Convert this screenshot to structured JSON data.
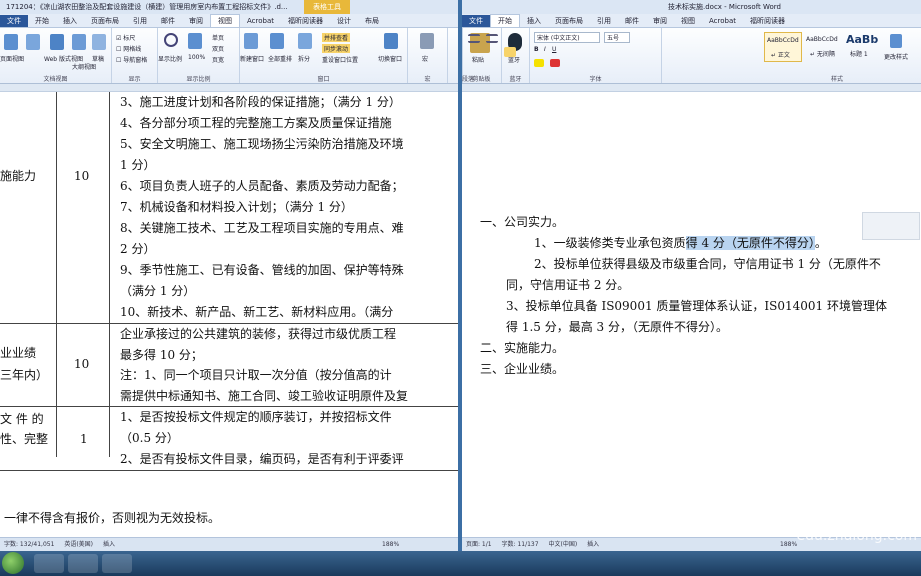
{
  "left_window": {
    "title": "171204：《凉山湖农田整治及配套设施建设（横建）管理用房室内布置工程招标文件》.d...",
    "context_tab": "表格工具",
    "tabs": [
      "文件",
      "开始",
      "插入",
      "页面布局",
      "引用",
      "邮件",
      "审阅",
      "视图",
      "Acrobat",
      "福昕阅读器",
      "设计",
      "布局"
    ],
    "active_tab": "视图",
    "ribbon_groups": [
      "文档视图",
      "显示",
      "显示比例",
      "窗口",
      "宏"
    ],
    "ribbon_labels": {
      "page_view": "页面视图",
      "read_view": "阅读版式视图",
      "web_view": "Web 版式视图",
      "outline": "大纲视图",
      "draft": "草稿",
      "ruler": "标尺",
      "grid": "网格线",
      "nav": "导航窗格",
      "zoom": "显示比例",
      "pct": "100%",
      "one_page": "单页",
      "two_page": "双页",
      "page_width": "页宽",
      "new_win": "新建窗口",
      "arrange": "全部重排",
      "split": "拆分",
      "side_by_side": "并排查看",
      "sync": "同步滚动",
      "reset": "重设窗口位置",
      "switch": "切换窗口",
      "macro": "宏"
    },
    "table": {
      "row1": {
        "label": "施能力",
        "score": "10",
        "lines": [
          "3、施工进度计划和各阶段的保证措施；（满分 1 分）",
          "4、各分部分项工程的完整施工方案及质量保证措施",
          "5、安全文明施工、施工现场扬尘污染防治措施及环境",
          "1 分）",
          "6、项目负责人班子的人员配备、素质及劳动力配备；",
          "7、机械设备和材料投入计划；（满分 1 分）",
          "8、关键施工技术、工艺及工程项目实施的专用点、难",
          "2 分）",
          "9、季节性施工、已有设备、管线的加固、保护等特殊",
          "（满分 1 分）",
          "10、新技术、新产品、新工艺、新材料应用。（满分"
        ]
      },
      "row2": {
        "label_a": "业业绩",
        "label_b": "三年内）",
        "score": "10",
        "lines": [
          "企业承接过的公共建筑的装修，获得过市级优质工程",
          "最多得 10 分；",
          "注：1、同一个项目只计取一次分值（按分值高的计",
          "需提供中标通知书、施工合同、竣工验收证明原件及复"
        ]
      },
      "row3": {
        "label_a": "文 件 的",
        "label_b": "性、完整",
        "score": "1",
        "lines": [
          "1、是否按投标文件规定的顺序装订，并按招标文件",
          "（0.5 分）",
          "2、是否有投标文件目录，编页码，是否有利于评委评"
        ]
      }
    },
    "footer_text": "一律不得含有报价，否则视为无效投标。",
    "status": {
      "words": "字数: 132/41,051",
      "lang": "英语(美国)",
      "mode": "插入",
      "zoom": "188%"
    }
  },
  "right_window": {
    "title": "技术标实施.docx - Microsoft Word",
    "tabs": [
      "文件",
      "开始",
      "插入",
      "页面布局",
      "引用",
      "邮件",
      "审阅",
      "视图",
      "Acrobat",
      "福昕阅读器"
    ],
    "active_tab": "开始",
    "ribbon_groups": [
      "剪贴板",
      "蓝牙",
      "字体",
      "段落",
      "样式"
    ],
    "ribbon_labels": {
      "paste": "粘贴",
      "bluetooth": "蓝牙",
      "font_name": "宋体 (中文正文)",
      "font_size": "五号",
      "style1": "AaBbCcDd",
      "style1_name": "↵ 正文",
      "style2": "AaBbCcDd",
      "style2_name": "↵ 无间隔",
      "style3": "AaBb",
      "style3_name": "标题 1",
      "change_styles": "更改样式"
    },
    "doc": {
      "h1": "一、公司实力。",
      "p1_before": "1、一级装修类专业承包资质",
      "p1_sel": "得 4 分（无原件不得分）",
      "p1_after": "。",
      "p2a": "2、投标单位获得县级及市级重合同，守信用证书 1 分（无原件不",
      "p2b": "同，守信用证书 2 分。",
      "p3a": "3、投标单位具备 IS09001 质量管理体系认证，IS014001 环境管理体",
      "p3b": "得 1.5 分，最高 3 分，（无原件不得分）。",
      "h2": "二、实施能力。",
      "h3": "三、企业业绩。"
    },
    "status": {
      "page": "页面: 1/1",
      "words": "字数: 11/137",
      "lang": "中文(中国)",
      "mode": "插入",
      "zoom": "188%"
    }
  },
  "watermark": "edu.zhulong.com",
  "colors": {
    "accent": "#2b579a",
    "selection": "#b9d4f0",
    "taskbar": "#1a3a5c"
  }
}
